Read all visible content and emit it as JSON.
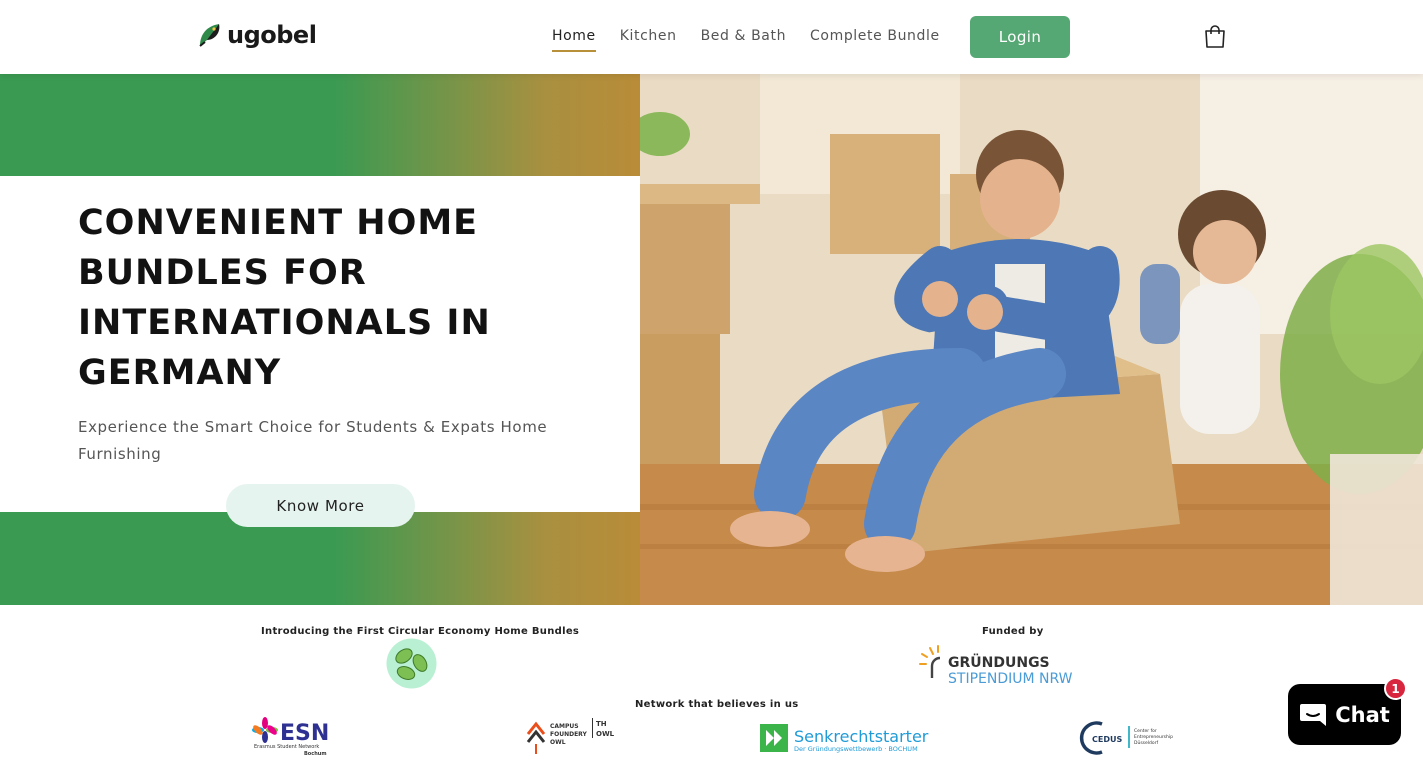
{
  "brand": {
    "name": "ugobel"
  },
  "nav": {
    "items": [
      {
        "label": "Home",
        "active": true
      },
      {
        "label": "Kitchen",
        "active": false
      },
      {
        "label": "Bed & Bath",
        "active": false
      },
      {
        "label": "Complete Bundle",
        "active": false
      }
    ],
    "login_label": "Login",
    "cart_icon": "cart-icon"
  },
  "hero": {
    "title": "CONVENIENT HOME BUNDLES FOR INTERNATIONALS IN GERMANY",
    "subtitle": "Experience the Smart Choice for Students & Expats Home Furnishing",
    "cta_label": "Know More",
    "photo_alt": "Young couple laughing while moving, man sitting in a cardboard box"
  },
  "sections": {
    "intro_label": "Introducing the First Circular Economy Home Bundles",
    "funded_label": "Funded by",
    "network_label": "Network that believes in us"
  },
  "logos": {
    "funder": {
      "line1": "GRÜNDUNGS",
      "line2": "STIPENDIUM NRW"
    },
    "partners": [
      {
        "name": "ESN",
        "tagline": "Erasmus Student Network",
        "city": "Bochum"
      },
      {
        "name": "CAMPUS FOUNDERY OWL",
        "extra": "TH OWL"
      },
      {
        "name": "Senkrechtstarter",
        "tagline": "Der Gründungswettbewerb · BOCHUM"
      },
      {
        "name": "CEDUS",
        "tagline": "Center for Entrepreneurship Düsseldorf"
      }
    ]
  },
  "chat": {
    "label": "Chat",
    "badge": "1"
  },
  "colors": {
    "accent_green": "#55a873",
    "hero_green": "#3a9a52",
    "hero_gold": "#b98c38",
    "nav_underline": "#b8903a",
    "chat_badge": "#d7263d"
  }
}
